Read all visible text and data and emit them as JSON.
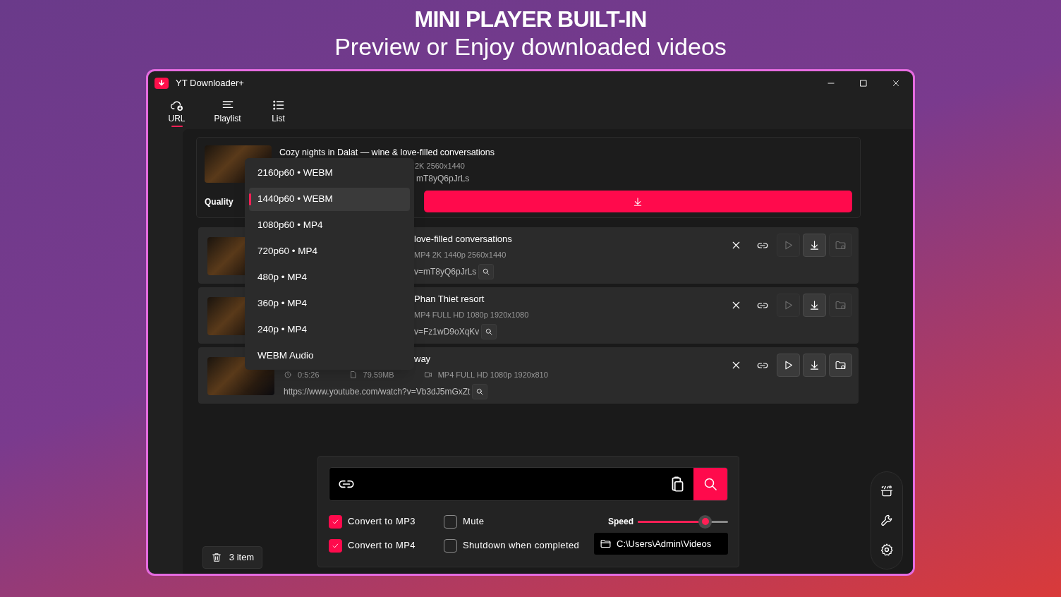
{
  "header": {
    "title": "MINI PLAYER BUILT-IN",
    "subtitle": "Preview or Enjoy downloaded videos"
  },
  "window": {
    "title": "YT Downloader+"
  },
  "tabs": [
    {
      "label": "URL",
      "selected": true
    },
    {
      "label": "Playlist",
      "selected": false
    },
    {
      "label": "List",
      "selected": false
    }
  ],
  "current_video": {
    "title": "Cozy nights in Dalat — wine & love-filled conversations",
    "details": "2K 2560x1440",
    "url": "mT8yQ6pJrLs",
    "quality_label": "Quality"
  },
  "quality_menu": [
    {
      "label": "2160p60 • WEBM",
      "selected": false
    },
    {
      "label": "1440p60 • WEBM",
      "selected": true
    },
    {
      "label": "1080p60 • MP4",
      "selected": false
    },
    {
      "label": "720p60 • MP4",
      "selected": false
    },
    {
      "label": "480p • MP4",
      "selected": false
    },
    {
      "label": "360p • MP4",
      "selected": false
    },
    {
      "label": "240p • MP4",
      "selected": false
    },
    {
      "label": "WEBM Audio",
      "selected": false
    }
  ],
  "downloads": [
    {
      "kind": "partly-hidden",
      "title": "love-filled conversations",
      "meta": [
        {
          "kind": "format",
          "text": "MP4 2K 1440p 2560x1440"
        }
      ],
      "url": "v=mT8yQ6pJrLs",
      "can_play": false,
      "can_open_folder": false
    },
    {
      "kind": "partly-hidden",
      "title": "Phan Thiet resort",
      "meta": [
        {
          "kind": "format",
          "text": "MP4 FULL HD 1080p 1920x1080"
        }
      ],
      "url": "v=Fz1wD9oXqKv",
      "can_play": false,
      "can_open_folder": false
    },
    {
      "kind": "title-covered",
      "title": "way",
      "meta": [
        {
          "kind": "duration",
          "text": "0:5:26"
        },
        {
          "kind": "size",
          "text": "79.59MB"
        },
        {
          "kind": "format",
          "text": "MP4 FULL HD 1080p 1920x810"
        }
      ],
      "url": "https://www.youtube.com/watch?v=Vb3dJ5mGxZt",
      "can_play": true,
      "can_open_folder": true
    }
  ],
  "options": [
    {
      "label": "Convert to MP3",
      "checked": true
    },
    {
      "label": "Convert to MP4",
      "checked": true
    },
    {
      "label": "Mute",
      "checked": false
    },
    {
      "label": "Shutdown when completed",
      "checked": false
    }
  ],
  "speed": {
    "label": "Speed",
    "level": 0.79
  },
  "folder": "C:\\Users\\Admin\\Videos",
  "item_count": "3 item"
}
